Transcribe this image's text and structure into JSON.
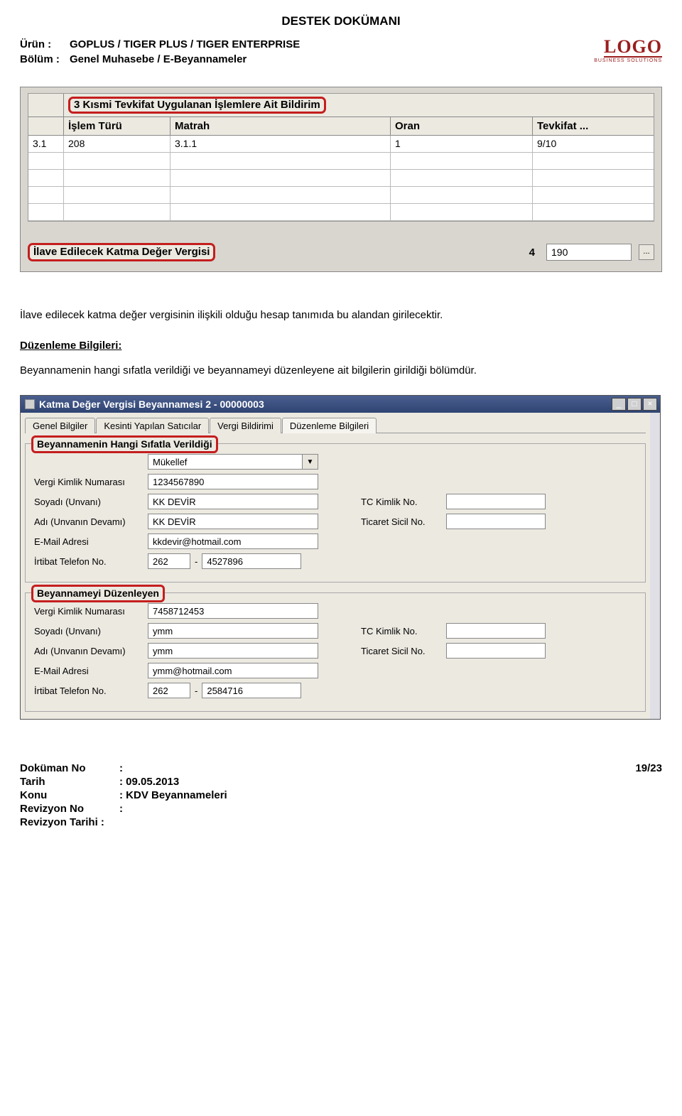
{
  "doc_title": "DESTEK DOKÜMANI",
  "header": {
    "labels": {
      "urun": "Ürün   :",
      "bolum": "Bölüm :"
    },
    "urun": "GOPLUS / TIGER PLUS / TIGER ENTERPRISE",
    "bolum": "Genel Muhasebe / E-Beyannameler"
  },
  "logo": {
    "text": "LOGO",
    "sub": "BUSINESS SOLUTIONS"
  },
  "shot1": {
    "title": "3 Kısmi Tevkifat Uygulanan İşlemlere Ait Bildirim",
    "headers": {
      "c2": "İşlem Türü",
      "c3": "Matrah",
      "c4": "Oran",
      "c5": "Tevkifat ..."
    },
    "rows": [
      {
        "c1": "3.1",
        "c2": "208",
        "c3": "3.1.1",
        "c4": "1",
        "c5": "9/10"
      },
      {
        "c1": "",
        "c2": "",
        "c3": "",
        "c4": "",
        "c5": ""
      },
      {
        "c1": "",
        "c2": "",
        "c3": "",
        "c4": "",
        "c5": ""
      },
      {
        "c1": "",
        "c2": "",
        "c3": "",
        "c4": "",
        "c5": ""
      },
      {
        "c1": "",
        "c2": "",
        "c3": "",
        "c4": "",
        "c5": ""
      }
    ],
    "ilave_label": "İlave Edilecek Katma Değer Vergisi",
    "ilave_num": "4",
    "ilave_value": "190",
    "ellipsis": "..."
  },
  "para1": "İlave edilecek katma değer vergisinin ilişkili olduğu hesap tanımıda bu alandan girilecektir.",
  "section_heading": "Düzenleme Bilgileri:",
  "para2": "Beyannamenin hangi sıfatla verildiği ve beyannameyi düzenleyene ait bilgilerin girildiği bölümdür.",
  "win": {
    "title": "Katma Değer Vergisi Beyannamesi 2 - 00000003",
    "tabs": [
      "Genel Bilgiler",
      "Kesinti Yapılan Satıcılar",
      "Vergi Bildirimi",
      "Düzenleme Bilgileri"
    ],
    "active_tab": 3,
    "fs1": {
      "legend": "Beyannamenin Hangi Sıfatla Verildiği",
      "dropdown": "Mükellef",
      "labels": {
        "vkn": "Vergi Kimlik Numarası",
        "soyadi": "Soyadı (Unvanı)",
        "adi": "Adı (Unvanın Devamı)",
        "email": "E-Mail Adresi",
        "tel": "İrtibat Telefon No.",
        "tc": "TC Kimlik No.",
        "ticaret": "Ticaret Sicil No."
      },
      "vkn": "1234567890",
      "soyadi": "KK DEVİR",
      "adi": "KK DEVİR",
      "email": "kkdevir@hotmail.com",
      "tel_area": "262",
      "tel_num": "4527896",
      "tc": "",
      "ticaret": ""
    },
    "fs2": {
      "legend": "Beyannameyi Düzenleyen",
      "labels": {
        "vkn": "Vergi Kimlik Numarası",
        "soyadi": "Soyadı (Unvanı)",
        "adi": "Adı (Unvanın Devamı)",
        "email": "E-Mail Adresi",
        "tel": "İrtibat Telefon No.",
        "tc": "TC Kimlik No.",
        "ticaret": "Ticaret Sicil No."
      },
      "vkn": "7458712453",
      "soyadi": "ymm",
      "adi": "ymm",
      "email": "ymm@hotmail.com",
      "tel_area": "262",
      "tel_num": "2584716",
      "tc": "",
      "ticaret": ""
    }
  },
  "footer": {
    "labels": {
      "dokuman": "Doküman No",
      "tarih": "Tarih",
      "konu": "Konu",
      "revno": "Revizyon No",
      "revtarih": "Revizyon Tarihi :"
    },
    "dokuman": ":",
    "tarih": ": 09.05.2013",
    "konu": ": KDV Beyannameleri",
    "revno": ":",
    "page": "19/23"
  }
}
